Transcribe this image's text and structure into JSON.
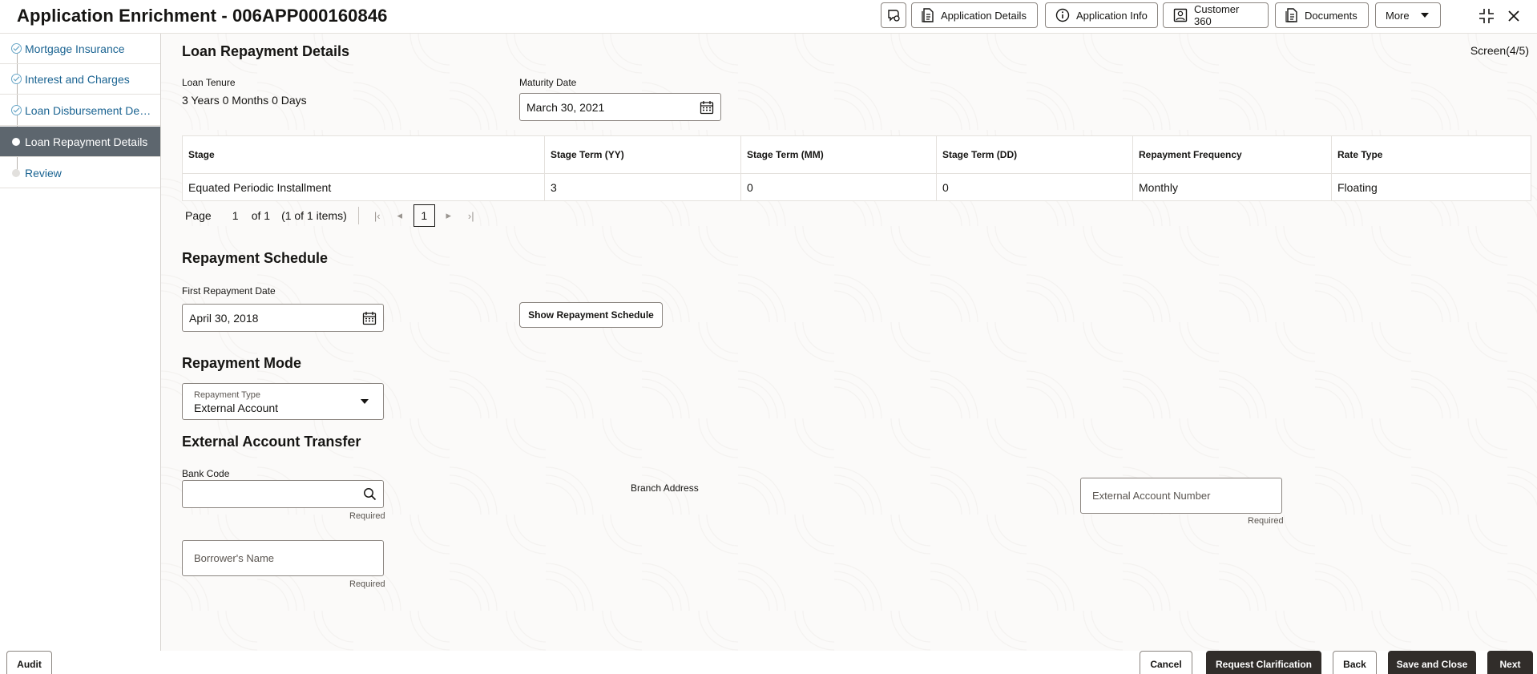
{
  "header": {
    "title": "Application Enrichment - 006APP000160846",
    "buttons": {
      "application_details": "Application Details",
      "application_info": "Application Info",
      "customer_360": "Customer 360",
      "documents": "Documents",
      "more": "More"
    }
  },
  "sidebar": {
    "steps": [
      {
        "label": "Mortgage Insurance",
        "state": "done"
      },
      {
        "label": "Interest and Charges",
        "state": "done"
      },
      {
        "label": "Loan Disbursement Details",
        "state": "done"
      },
      {
        "label": "Loan Repayment Details",
        "state": "active"
      },
      {
        "label": "Review",
        "state": "pending"
      }
    ]
  },
  "main": {
    "screen_indicator": "Screen(4/5)",
    "loan_repayment": {
      "title": "Loan Repayment Details",
      "loan_tenure_label": "Loan Tenure",
      "loan_tenure_value": "3 Years 0 Months 0 Days",
      "maturity_date_label": "Maturity Date",
      "maturity_date_value": "March 30, 2021"
    },
    "table": {
      "headers": [
        "Stage",
        "Stage Term (YY)",
        "Stage Term (MM)",
        "Stage Term (DD)",
        "Repayment Frequency",
        "Rate Type"
      ],
      "rows": [
        [
          "Equated Periodic Installment",
          "3",
          "0",
          "0",
          "Monthly",
          "Floating"
        ]
      ]
    },
    "pager": {
      "page_label": "Page",
      "page_value": "1",
      "of_label": "of 1",
      "items_label": "(1 of 1 items)",
      "current_page": "1"
    },
    "repayment_schedule": {
      "title": "Repayment Schedule",
      "first_date_label": "First Repayment Date",
      "first_date_value": "April 30, 2018",
      "show_button": "Show Repayment Schedule"
    },
    "repayment_mode": {
      "title": "Repayment Mode",
      "type_label": "Repayment Type",
      "type_value": "External Account"
    },
    "external_transfer": {
      "title": "External Account Transfer",
      "bank_code_label": "Bank Code",
      "bank_code_value": "",
      "branch_address_label": "Branch Address",
      "external_account_placeholder": "External Account Number",
      "borrower_name_placeholder": "Borrower's Name",
      "required_text": "Required"
    }
  },
  "footer": {
    "audit": "Audit",
    "cancel": "Cancel",
    "request_clarification": "Request Clarification",
    "back": "Back",
    "save_and_close": "Save and Close",
    "next": "Next"
  },
  "colors": {
    "accent_link": "#1b6492",
    "active_step_bg": "#5d666e",
    "dark_button": "#312d2a"
  }
}
